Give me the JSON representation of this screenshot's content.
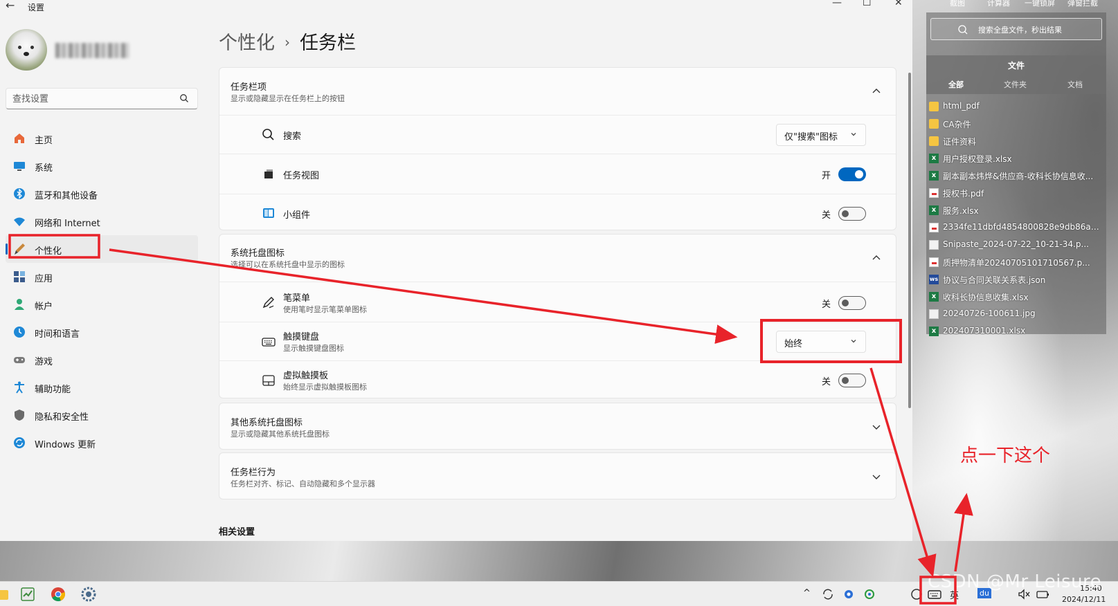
{
  "window": {
    "title": "设置",
    "back_glyph": "←",
    "min_glyph": "—",
    "max_glyph": "☐",
    "close_glyph": "✕"
  },
  "search": {
    "placeholder": "查找设置"
  },
  "sidebar": {
    "items": [
      {
        "label": "主页",
        "icon": "home-icon",
        "color": "#e8683a"
      },
      {
        "label": "系统",
        "icon": "monitor-icon",
        "color": "#1e88d6"
      },
      {
        "label": "蓝牙和其他设备",
        "icon": "bluetooth-icon",
        "color": "#1e88d6"
      },
      {
        "label": "网络和 Internet",
        "icon": "wifi-icon",
        "color": "#1e88d6"
      },
      {
        "label": "个性化",
        "icon": "brush-icon",
        "color": "#c9883c"
      },
      {
        "label": "应用",
        "icon": "apps-icon",
        "color": "#3b5c8c"
      },
      {
        "label": "帐户",
        "icon": "person-icon",
        "color": "#2fa876"
      },
      {
        "label": "时间和语言",
        "icon": "globe-clock-icon",
        "color": "#1e88d6"
      },
      {
        "label": "游戏",
        "icon": "gamepad-icon",
        "color": "#7a7a7a"
      },
      {
        "label": "辅助功能",
        "icon": "accessibility-icon",
        "color": "#1e88d6"
      },
      {
        "label": "隐私和安全性",
        "icon": "shield-icon",
        "color": "#6a6a6a"
      },
      {
        "label": "Windows 更新",
        "icon": "update-icon",
        "color": "#1e88d6"
      }
    ],
    "active_index": 4
  },
  "breadcrumb": {
    "parent": "个性化",
    "separator": "›",
    "current": "任务栏"
  },
  "taskbar_items": {
    "title": "任务栏项",
    "subtitle": "显示或隐藏显示在任务栏上的按钮",
    "rows": [
      {
        "name": "搜索",
        "icon": "search-icon",
        "dropdown": "仅\"搜索\"图标"
      },
      {
        "name": "任务视图",
        "icon": "task-view-icon",
        "state": "开"
      },
      {
        "name": "小组件",
        "icon": "widgets-icon",
        "state": "关"
      }
    ]
  },
  "tray_icons": {
    "title": "系统托盘图标",
    "subtitle": "选择可以在系统托盘中显示的图标",
    "rows": [
      {
        "name": "笔菜单",
        "desc": "使用笔时显示笔菜单图标",
        "icon": "pen-icon",
        "state": "关"
      },
      {
        "name": "触摸键盘",
        "desc": "显示触摸键盘图标",
        "icon": "keyboard-icon",
        "dropdown": "始终"
      },
      {
        "name": "虚拟触摸板",
        "desc": "始终显示虚拟触摸板图标",
        "icon": "touchpad-icon",
        "state": "关"
      }
    ]
  },
  "other_tray": {
    "title": "其他系统托盘图标",
    "subtitle": "显示或隐藏其他系统托盘图标"
  },
  "behavior": {
    "title": "任务栏行为",
    "subtitle": "任务栏对齐、标记、自动隐藏和多个显示器"
  },
  "related": "相关设置",
  "panel": {
    "top_links": [
      "截图",
      "计算器",
      "一键锁屏",
      "弹窗拦截"
    ],
    "search_text": "搜索全盘文件，秒出结果",
    "section": "文件",
    "tabs": [
      "全部",
      "文件夹",
      "文档"
    ],
    "files": [
      {
        "name": "html_pdf",
        "type": "folder"
      },
      {
        "name": "CA杂件",
        "type": "folder"
      },
      {
        "name": "证件资料",
        "type": "folder"
      },
      {
        "name": "用户授权登录.xlsx",
        "type": "xlsx"
      },
      {
        "name": "副本副本炜烨&供应商-收科长协信息收...",
        "type": "xlsx"
      },
      {
        "name": "授权书.pdf",
        "type": "pdf"
      },
      {
        "name": "服务.xlsx",
        "type": "xlsx"
      },
      {
        "name": "2334fe11dbfd4854800828e9db86a6...",
        "type": "pdf"
      },
      {
        "name": "Snipaste_2024-07-22_10-21-34.p...",
        "type": "img"
      },
      {
        "name": "质押物清单20240705101710567.p...",
        "type": "pdf"
      },
      {
        "name": "协议与合同关联关系表.json",
        "type": "json"
      },
      {
        "name": "收科长协信息收集.xlsx",
        "type": "xlsx"
      },
      {
        "name": "20240726-100611.jpg",
        "type": "img"
      },
      {
        "name": "202407310001.xlsx",
        "type": "xlsx"
      }
    ]
  },
  "annotation": {
    "text": "点一下这个",
    "color": "#e8232a"
  },
  "taskbar": {
    "tray_lang": "英",
    "time": "15:40",
    "date": "2024/12/11",
    "chevron": "^",
    "du_label": "du"
  },
  "watermark": "CSDN @Mr Leisure",
  "colors": {
    "accent": "#0067c0",
    "annotation": "#e8232a"
  }
}
